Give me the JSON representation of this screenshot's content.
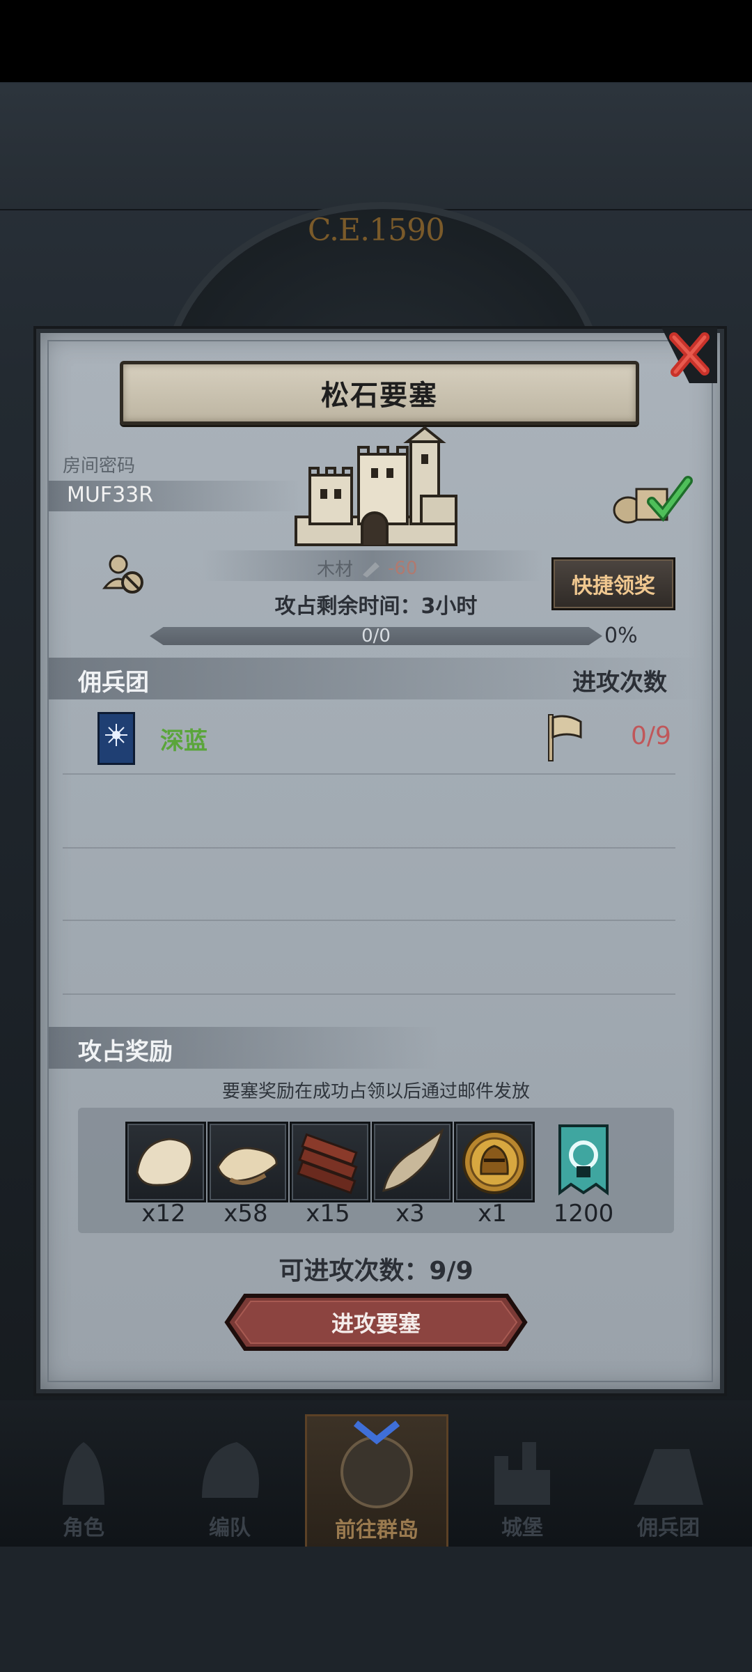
{
  "header": {
    "year": "C.E.1590"
  },
  "dialog": {
    "title": "松石要塞",
    "room_code_label": "房间密码",
    "room_code": "MUF33R",
    "resource_label": "木材",
    "resource_value": "-60",
    "quick_claim": "快捷领奖",
    "time_remaining": "攻占剩余时间：3小时",
    "progress_text": "0/0",
    "progress_percent": "0%",
    "progress_fraction": 0
  },
  "mercenary": {
    "header_left": "佣兵团",
    "header_right": "进攻次数",
    "rows": [
      {
        "name": "深蓝",
        "count": "0/9"
      }
    ]
  },
  "rewards": {
    "header": "攻占奖励",
    "note": "要塞奖励在成功占领以后通过邮件发放",
    "items": [
      {
        "icon": "fur-pelt-icon",
        "qty": "x12"
      },
      {
        "icon": "hide-icon",
        "qty": "x58"
      },
      {
        "icon": "wood-planks-icon",
        "qty": "x15"
      },
      {
        "icon": "horn-icon",
        "qty": "x3"
      },
      {
        "icon": "knight-helmet-medal-icon",
        "qty": "x1"
      },
      {
        "icon": "guild-banner-icon",
        "qty": "1200"
      }
    ]
  },
  "attacks_available": "可进攻次数：9/9",
  "attack_button": "进攻要塞",
  "nav": {
    "items": [
      {
        "label": "角色"
      },
      {
        "label": "编队"
      },
      {
        "label": "前往群岛"
      },
      {
        "label": "城堡"
      },
      {
        "label": "佣兵团"
      }
    ],
    "active_index": 2
  }
}
